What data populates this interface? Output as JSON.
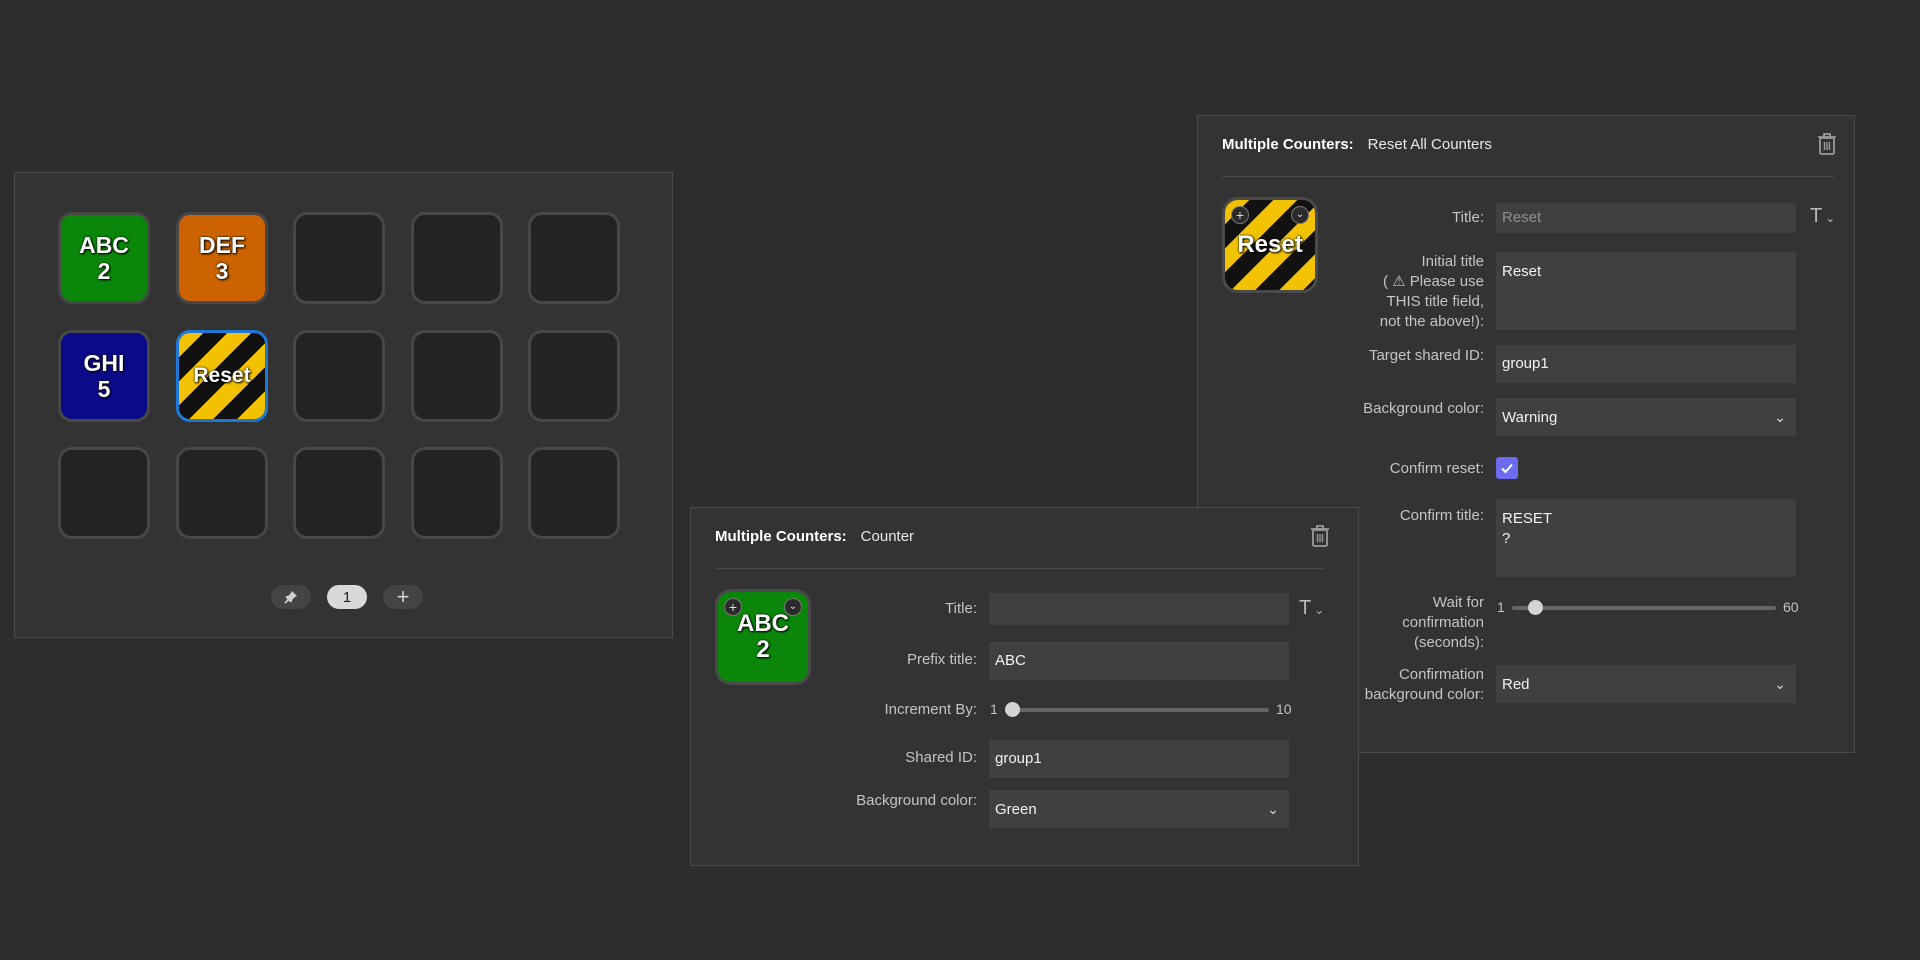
{
  "deck": {
    "keys": [
      {
        "label": "ABC\n2",
        "color": "#0a870a"
      },
      {
        "label": "DEF\n3",
        "color": "#cc6200"
      },
      {
        "label": "GHI\n5",
        "color": "#0b0b8a"
      },
      {
        "label": "Reset",
        "color": "warning-stripes"
      }
    ],
    "page_number": "1",
    "pin_icon": "pin-icon",
    "add_page_icon": "plus-icon"
  },
  "reset_inspector": {
    "plugin_name": "Multiple Counters:",
    "action_name": "Reset All Counters",
    "preview_label": "Reset",
    "title_label": "Title:",
    "title_value": "Reset",
    "initial_title_label_line1": "Initial title",
    "initial_title_label_line2": "( ⚠ Please use",
    "initial_title_label_line3": "THIS title field,",
    "initial_title_label_line4": "not the above!):",
    "initial_title_value": "Reset",
    "target_id_label": "Target shared ID:",
    "target_id_value": "group1",
    "bg_color_label": "Background color:",
    "bg_color_value": "Warning",
    "confirm_reset_label": "Confirm reset:",
    "confirm_reset_checked": true,
    "confirm_title_label": "Confirm title:",
    "confirm_title_value": "RESET\n?",
    "wait_label": "Wait for confirmation (seconds):",
    "wait_min": "1",
    "wait_max": "60",
    "wait_value": 3,
    "confirm_bg_label": "Confirmation background color:",
    "confirm_bg_value": "Red"
  },
  "counter_inspector": {
    "plugin_name": "Multiple Counters:",
    "action_name": "Counter",
    "preview_label": "ABC\n2",
    "preview_color": "#0a870a",
    "title_label": "Title:",
    "title_value": "",
    "prefix_label": "Prefix title:",
    "prefix_value": "ABC",
    "increment_label": "Increment By:",
    "increment_min": "1",
    "increment_max": "10",
    "increment_value": 1,
    "shared_id_label": "Shared ID:",
    "shared_id_value": "group1",
    "bg_color_label": "Background color:",
    "bg_color_value": "Green"
  }
}
